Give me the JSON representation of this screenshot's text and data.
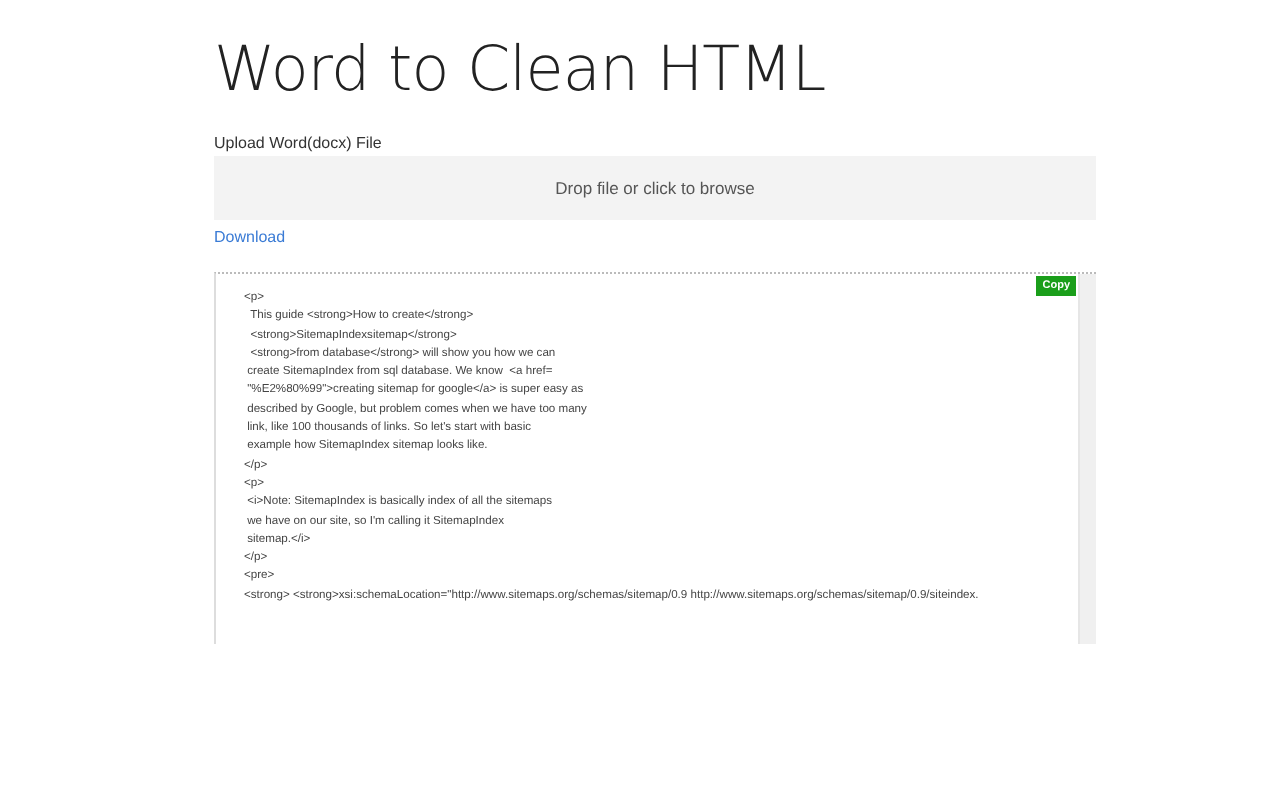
{
  "title": "Word to Clean HTML",
  "upload": {
    "label": "Upload Word(docx) File",
    "dropzone": "Drop file or click to browse"
  },
  "download_link": "Download",
  "output": {
    "copy_button": "Copy",
    "lines": [
      "<p>",
      "  This guide <strong>How to create</strong>",
      "  <strong>SitemapIndexsitemap</strong>",
      "  <strong>from database</strong> will show you how we can",
      " create SitemapIndex from sql database. We know  <a href=",
      " \"%E2%80%99\">creating sitemap for google</a> is super easy as",
      " described by Google, but problem comes when we have too many",
      " link, like 100 thousands of links. So let's start with basic",
      " example how SitemapIndex sitemap looks like.",
      "</p>",
      "<p>",
      " <i>Note: SitemapIndex is basically index of all the sitemaps",
      " we have on our site, so I'm calling it SitemapIndex",
      " sitemap.</i>",
      "</p>",
      "<pre>",
      "<strong> <strong>xsi:schemaLocation=\"http://www.sitemaps.org/schemas/sitemap/0.9 http://www.sitemaps.org/schemas/sitemap/0.9/siteindex."
    ]
  }
}
